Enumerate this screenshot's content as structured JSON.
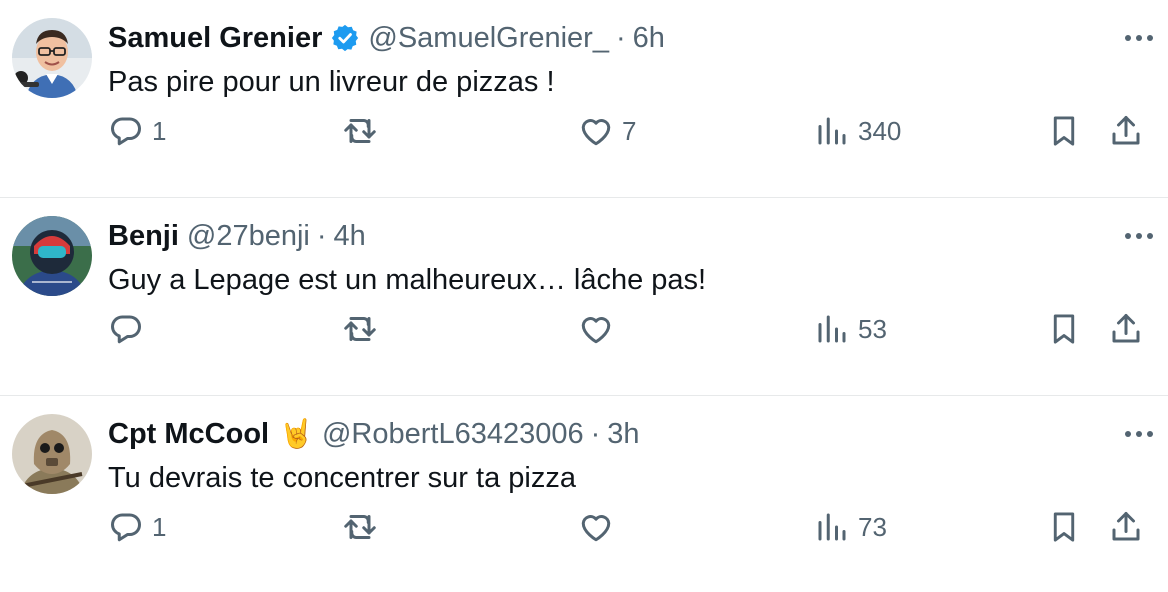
{
  "tweets": [
    {
      "name": "Samuel Grenier",
      "verified": true,
      "emoji": "",
      "handle": "@SamuelGrenier_",
      "separator": "·",
      "time": "6h",
      "text": "Pas pire pour un livreur de pizzas !",
      "replies": "1",
      "retweets": "",
      "likes": "7",
      "views": "340"
    },
    {
      "name": "Benji",
      "verified": false,
      "emoji": "",
      "handle": "@27benji",
      "separator": "·",
      "time": "4h",
      "text": "Guy a Lepage est un malheureux… lâche pas!",
      "replies": "",
      "retweets": "",
      "likes": "",
      "views": "53"
    },
    {
      "name": "Cpt McCool",
      "verified": false,
      "emoji": "🤘",
      "handle": "@RobertL63423006",
      "separator": "·",
      "time": "3h",
      "text": "Tu devrais te concentrer sur ta pizza",
      "replies": "1",
      "retweets": "",
      "likes": "",
      "views": "73"
    }
  ],
  "colors": {
    "text": "#0f1419",
    "secondary": "#536471",
    "verified": "#1d9bf0",
    "divider": "#e7e9ea"
  },
  "icons": [
    "reply-icon",
    "retweet-icon",
    "like-icon",
    "views-icon",
    "bookmark-icon",
    "share-icon",
    "more-icon",
    "verified-badge-icon"
  ]
}
